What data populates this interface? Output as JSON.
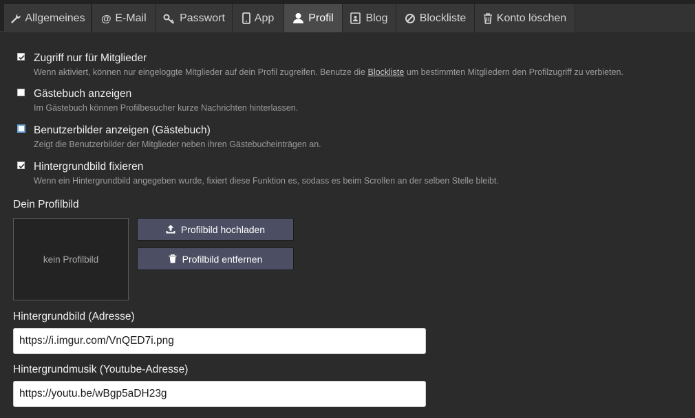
{
  "tabs": [
    {
      "label": "Allgemeines",
      "icon": "wrench-icon"
    },
    {
      "label": "E-Mail",
      "icon": "at-icon"
    },
    {
      "label": "Passwort",
      "icon": "key-icon"
    },
    {
      "label": "App",
      "icon": "phone-icon"
    },
    {
      "label": "Profil",
      "icon": "user-icon"
    },
    {
      "label": "Blog",
      "icon": "blog-icon"
    },
    {
      "label": "Blockliste",
      "icon": "block-icon"
    },
    {
      "label": "Konto löschen",
      "icon": "trash-icon"
    }
  ],
  "active_tab": "Profil",
  "options": [
    {
      "title": "Zugriff nur für Mitglieder",
      "checked": true,
      "desc_before": "Wenn aktiviert, können nur eingeloggte Mitglieder auf dein Profil zugreifen. Benutze die ",
      "desc_link": "Blockliste",
      "desc_after": " um bestimmten Mitgliedern den Profilzugriff zu verbieten."
    },
    {
      "title": "Gästebuch anzeigen",
      "checked": false,
      "desc": "Im Gästebuch können Profilbesucher kurze Nachrichten hinterlassen."
    },
    {
      "title": "Benutzerbilder anzeigen (Gästebuch)",
      "checked": false,
      "desc": "Zeigt die Benutzerbilder der Mitglieder neben ihren Gästebucheinträgen an."
    },
    {
      "title": "Hintergrundbild fixieren",
      "checked": true,
      "desc": "Wenn ein Hintergrundbild angegeben wurde, fixiert diese Funktion es, sodass es beim Scrollen an der selben Stelle bleibt."
    }
  ],
  "profile_picture": {
    "label": "Dein Profilbild",
    "empty_text": "kein Profilbild",
    "upload_label": "Profilbild hochladen",
    "remove_label": "Profilbild entfernen"
  },
  "background_image": {
    "label": "Hintergrundbild (Adresse)",
    "value": "https://i.imgur.com/VnQED7i.png"
  },
  "background_music": {
    "label": "Hintergrundmusik (Youtube-Adresse)",
    "value": "https://youtu.be/wBgp5aDH23g"
  },
  "colors": {
    "background": "#2b2b2b",
    "tab": "#383838",
    "tab_active": "#4a4a4a",
    "button": "#4c4e63"
  }
}
